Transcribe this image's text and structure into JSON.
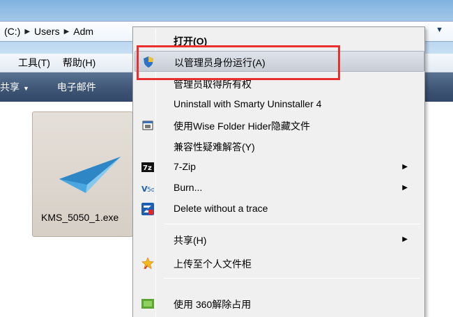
{
  "address_bar": {
    "crumbs": [
      "(C:)",
      "Users",
      "Adm"
    ],
    "dropdown_icon": "chevron-down-icon"
  },
  "menubar": {
    "items": [
      "工具(T)",
      "帮助(H)"
    ]
  },
  "toolbar": {
    "share_label": "共享",
    "email_label": "电子邮件"
  },
  "file": {
    "name": "KMS_5050_1.exe",
    "icon": "paper-plane-icon"
  },
  "context_menu": {
    "items": [
      {
        "label": "打开(O)",
        "bold": true,
        "icon": ""
      },
      {
        "label": "以管理员身份运行(A)",
        "highlighted": true,
        "icon": "uac-shield-icon"
      },
      {
        "label": "管理员取得所有权",
        "icon": ""
      },
      {
        "label": "Uninstall with Smarty Uninstaller 4",
        "icon": ""
      },
      {
        "label": "使用Wise Folder Hider隐藏文件",
        "icon": "wise-folder-hider-icon"
      },
      {
        "label": "兼容性疑难解答(Y)",
        "icon": ""
      },
      {
        "label": "7-Zip",
        "icon": "7zip-icon",
        "submenu": true
      },
      {
        "label": "Burn...",
        "icon": "burn-icon",
        "submenu": true
      },
      {
        "label": "Delete without a trace",
        "icon": "delete-trace-icon"
      },
      {
        "label": "共享(H)",
        "icon": "",
        "submenu": true
      },
      {
        "label": "上传至个人文件柜",
        "icon": "star-icon"
      },
      {
        "label": "使用 360解除占用",
        "icon": "360-icon"
      }
    ]
  },
  "colors": {
    "highlight_box": "#e9302f",
    "toolbar": "#3d5474"
  }
}
